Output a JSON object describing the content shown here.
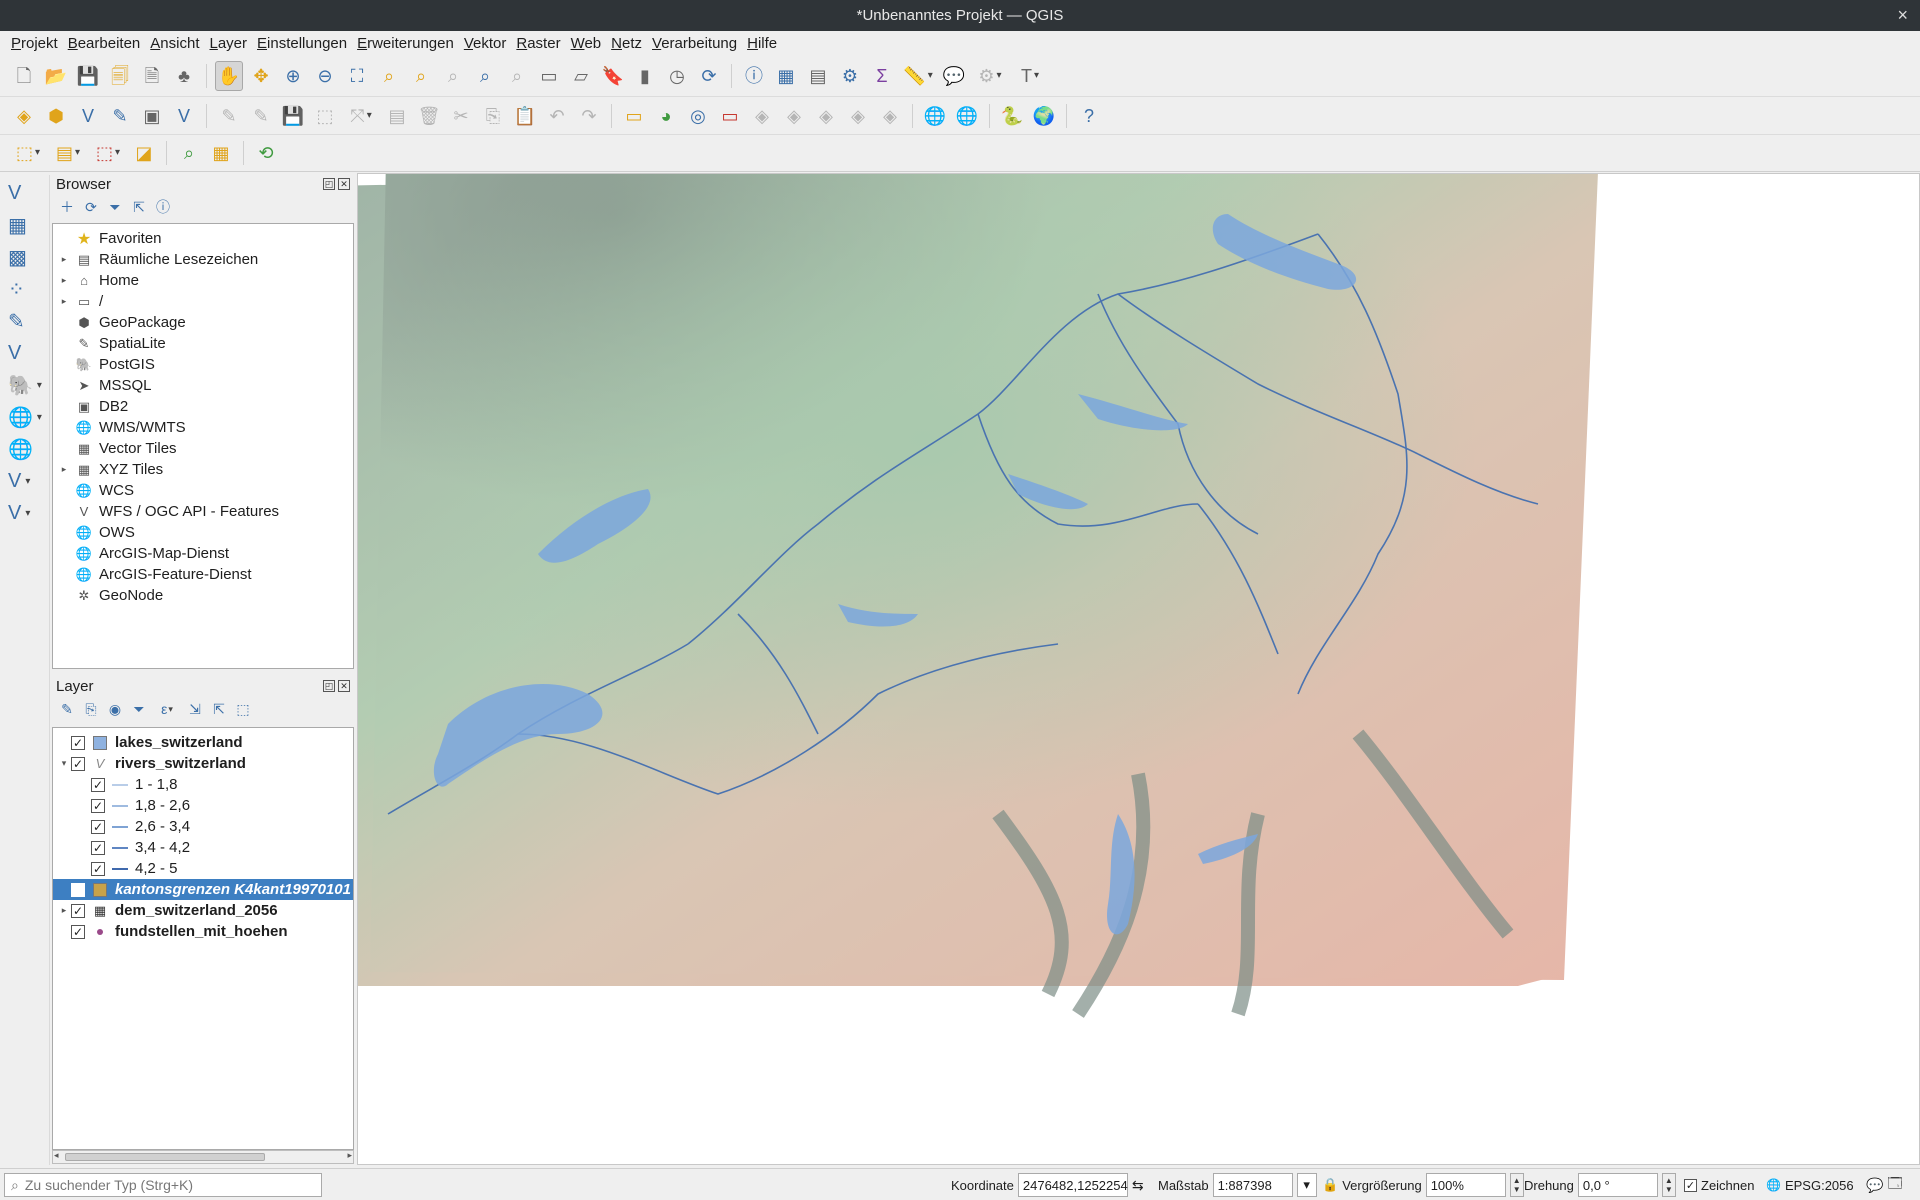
{
  "window": {
    "title": "*Unbenanntes Projekt — QGIS",
    "close_glyph": "×"
  },
  "menu": [
    "Projekt",
    "Bearbeiten",
    "Ansicht",
    "Layer",
    "Einstellungen",
    "Erweiterungen",
    "Vektor",
    "Raster",
    "Web",
    "Netz",
    "Verarbeitung",
    "Hilfe"
  ],
  "browser": {
    "title": "Browser",
    "items": [
      {
        "label": "Favoriten",
        "icon": "star-icon",
        "expandable": false
      },
      {
        "label": "Räumliche Lesezeichen",
        "icon": "bookmark-icon",
        "expandable": true
      },
      {
        "label": "Home",
        "icon": "home-folder-icon",
        "expandable": true
      },
      {
        "label": "/",
        "icon": "folder-icon",
        "expandable": true
      },
      {
        "label": "GeoPackage",
        "icon": "geopackage-icon",
        "expandable": false
      },
      {
        "label": "SpatiaLite",
        "icon": "spatialite-icon",
        "expandable": false
      },
      {
        "label": "PostGIS",
        "icon": "postgis-icon",
        "expandable": false
      },
      {
        "label": "MSSQL",
        "icon": "mssql-icon",
        "expandable": false
      },
      {
        "label": "DB2",
        "icon": "db2-icon",
        "expandable": false
      },
      {
        "label": "WMS/WMTS",
        "icon": "wms-globe-icon",
        "expandable": false
      },
      {
        "label": "Vector Tiles",
        "icon": "vector-tiles-icon",
        "expandable": false
      },
      {
        "label": "XYZ Tiles",
        "icon": "xyz-tiles-icon",
        "expandable": true
      },
      {
        "label": "WCS",
        "icon": "wcs-globe-icon",
        "expandable": false
      },
      {
        "label": "WFS / OGC API - Features",
        "icon": "wfs-icon",
        "expandable": false
      },
      {
        "label": "OWS",
        "icon": "ows-globe-icon",
        "expandable": false
      },
      {
        "label": "ArcGIS-Map-Dienst",
        "icon": "arcgis-map-icon",
        "expandable": false
      },
      {
        "label": "ArcGIS-Feature-Dienst",
        "icon": "arcgis-feature-icon",
        "expandable": false
      },
      {
        "label": "GeoNode",
        "icon": "geonode-icon",
        "expandable": false
      }
    ]
  },
  "layers": {
    "title": "Layer",
    "items": [
      {
        "label": "lakes_switzerland",
        "checked": true,
        "bold": true,
        "indent": 0,
        "twisty": "",
        "icon": "polygon-fill-icon",
        "color": "#8fb2e0",
        "selected": false
      },
      {
        "label": "rivers_switzerland",
        "checked": true,
        "bold": true,
        "indent": 0,
        "twisty": "▾",
        "icon": "line-layer-icon",
        "color": "#888888",
        "selected": false
      },
      {
        "label": "1 - 1,8",
        "checked": true,
        "bold": false,
        "indent": 1,
        "twisty": "",
        "icon": "line-class-icon",
        "color": "#b9cde8",
        "selected": false
      },
      {
        "label": "1,8 - 2,6",
        "checked": true,
        "bold": false,
        "indent": 1,
        "twisty": "",
        "icon": "line-class-icon",
        "color": "#9fbbe0",
        "selected": false
      },
      {
        "label": "2,6 - 3,4",
        "checked": true,
        "bold": false,
        "indent": 1,
        "twisty": "",
        "icon": "line-class-icon",
        "color": "#7fa3d4",
        "selected": false
      },
      {
        "label": "3,4 - 4,2",
        "checked": true,
        "bold": false,
        "indent": 1,
        "twisty": "",
        "icon": "line-class-icon",
        "color": "#5f86c2",
        "selected": false
      },
      {
        "label": "4,2 - 5",
        "checked": true,
        "bold": false,
        "indent": 1,
        "twisty": "",
        "icon": "line-class-icon",
        "color": "#3f69ad",
        "selected": false
      },
      {
        "label": "kantonsgrenzen K4kant19970101",
        "checked": false,
        "bold": true,
        "indent": 0,
        "twisty": "",
        "icon": "polygon-fill-icon",
        "color": "#c8a24a",
        "selected": true
      },
      {
        "label": "dem_switzerland_2056",
        "checked": true,
        "bold": true,
        "indent": 0,
        "twisty": "▸",
        "icon": "raster-icon",
        "color": "#333333",
        "selected": false
      },
      {
        "label": "fundstellen_mit_hoehen",
        "checked": true,
        "bold": true,
        "indent": 0,
        "twisty": "",
        "icon": "point-icon",
        "color": "#9a4a8a",
        "selected": false
      }
    ]
  },
  "status": {
    "locator_placeholder": "Zu suchender Typ (Strg+K)",
    "koordinate_label": "Koordinate",
    "koordinate_value": "2476482,1252254",
    "massstab_label": "Maßstab",
    "massstab_value": "1:887398",
    "vergroesserung_label": "Vergrößerung",
    "vergroesserung_value": "100%",
    "drehung_label": "Drehung",
    "drehung_value": "0,0 °",
    "zeichnen_label": "Zeichnen",
    "zeichnen_checked": true,
    "crs_label": "EPSG:2056"
  },
  "colors": {
    "lake": "#7ba7dd",
    "river": "#4a73b0",
    "lowland": "#a8c4aa",
    "alpine": "#e3b3a6",
    "valley": "#8a9890",
    "selection": "#3d7fc2"
  }
}
